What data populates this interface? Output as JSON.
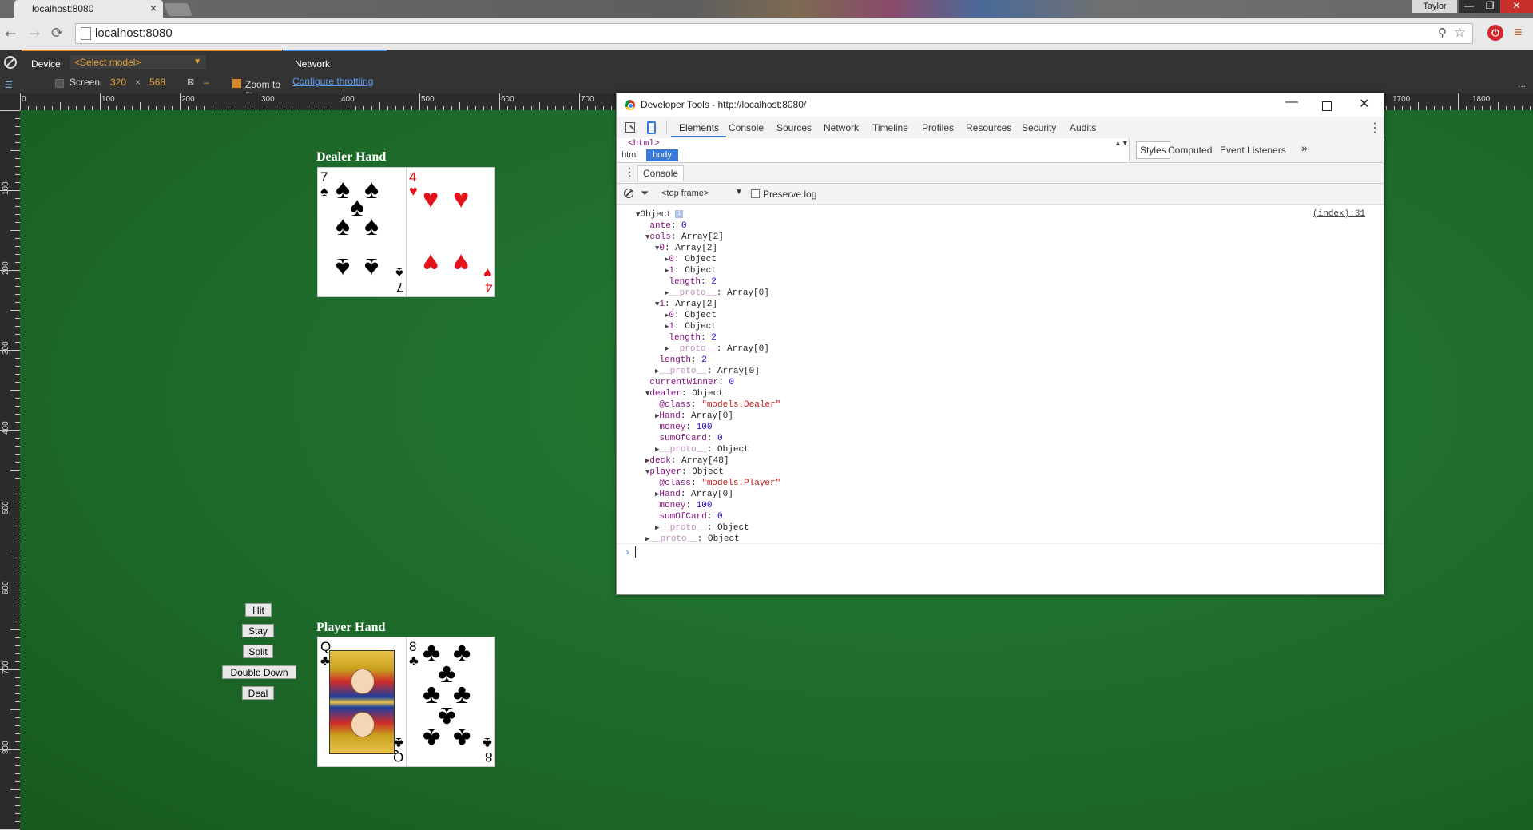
{
  "browser": {
    "tab_title": "localhost:8080",
    "tab_close": "×",
    "url": "localhost:8080",
    "user": "Taylor",
    "win_min": "—",
    "win_max": "❐",
    "win_close": "✕"
  },
  "emulation": {
    "device_label": "Device",
    "model_placeholder": "<Select model>",
    "screen_label": "Screen",
    "screen_width": "320",
    "times": "×",
    "screen_height": "568",
    "dash": "–",
    "zoom_to_fit": "Zoom to fit",
    "network_label": "Network",
    "throttle_link": "Configure throttling",
    "more": "..."
  },
  "ruler": {
    "top": [
      "0",
      "100",
      "200",
      "300",
      "400",
      "500",
      "600",
      "700",
      "1700",
      "1800"
    ],
    "left": [
      "100",
      "200",
      "300",
      "400",
      "500",
      "600",
      "700",
      "800"
    ]
  },
  "game": {
    "dealer_label": "Dealer Hand",
    "player_label": "Player Hand",
    "dealer_cards": [
      {
        "rank": "7",
        "suit": "♠",
        "color": "#000000"
      },
      {
        "rank": "4",
        "suit": "♥",
        "color": "#e3131b"
      }
    ],
    "player_cards": [
      {
        "rank": "Q",
        "suit": "♣",
        "color": "#000000"
      },
      {
        "rank": "8",
        "suit": "♣",
        "color": "#000000"
      }
    ],
    "buttons": {
      "hit": "Hit",
      "stay": "Stay",
      "split": "Split",
      "double_down": "Double Down",
      "deal": "Deal"
    },
    "felt_color": "#1f6b2b"
  },
  "devtools": {
    "title": "Developer Tools - http://localhost:8080/",
    "tabs": [
      "Elements",
      "Console",
      "Sources",
      "Network",
      "Timeline",
      "Profiles",
      "Resources",
      "Security",
      "Audits"
    ],
    "active_tab": "Elements",
    "html_tag": "<html>",
    "breadcrumb_html": "html",
    "breadcrumb_body": "body",
    "style_tabs": [
      "Styles",
      "Computed",
      "Event Listeners"
    ],
    "more_tabs": "»",
    "drawer_tab": "Console",
    "frame": "<top frame>",
    "preserve_log": "Preserve log",
    "source_link": "(index):31",
    "accent": "#3879d9"
  },
  "console_lines": [
    {
      "indent": 0,
      "tri": "▼",
      "key": "Object",
      "val": ""
    },
    {
      "indent": 1,
      "tri": "",
      "key": "ante",
      "val": "0"
    },
    {
      "indent": 1,
      "tri": "▼",
      "key": "cols",
      "val": "Array[2]"
    },
    {
      "indent": 2,
      "tri": "▼",
      "key": "0",
      "val": "Array[2]"
    },
    {
      "indent": 3,
      "tri": "▶",
      "key": "0",
      "val": "Object"
    },
    {
      "indent": 3,
      "tri": "▶",
      "key": "1",
      "val": "Object"
    },
    {
      "indent": 3,
      "tri": "",
      "key": "length",
      "val": "2"
    },
    {
      "indent": 3,
      "tri": "▶",
      "key": "__proto__",
      "val": "Array[0]"
    },
    {
      "indent": 2,
      "tri": "▼",
      "key": "1",
      "val": "Array[2]"
    },
    {
      "indent": 3,
      "tri": "▶",
      "key": "0",
      "val": "Object"
    },
    {
      "indent": 3,
      "tri": "▶",
      "key": "1",
      "val": "Object"
    },
    {
      "indent": 3,
      "tri": "",
      "key": "length",
      "val": "2"
    },
    {
      "indent": 3,
      "tri": "▶",
      "key": "__proto__",
      "val": "Array[0]"
    },
    {
      "indent": 2,
      "tri": "",
      "key": "length",
      "val": "2"
    },
    {
      "indent": 2,
      "tri": "▶",
      "key": "__proto__",
      "val": "Array[0]"
    },
    {
      "indent": 1,
      "tri": "",
      "key": "currentWinner",
      "val": "0"
    },
    {
      "indent": 1,
      "tri": "▼",
      "key": "dealer",
      "val": "Object"
    },
    {
      "indent": 2,
      "tri": "",
      "key": "@class",
      "val": "\"models.Dealer\""
    },
    {
      "indent": 2,
      "tri": "▶",
      "key": "Hand",
      "val": "Array[0]"
    },
    {
      "indent": 2,
      "tri": "",
      "key": "money",
      "val": "100"
    },
    {
      "indent": 2,
      "tri": "",
      "key": "sumOfCard",
      "val": "0"
    },
    {
      "indent": 2,
      "tri": "▶",
      "key": "__proto__",
      "val": "Object"
    },
    {
      "indent": 1,
      "tri": "▶",
      "key": "deck",
      "val": "Array[48]"
    },
    {
      "indent": 1,
      "tri": "▼",
      "key": "player",
      "val": "Object"
    },
    {
      "indent": 2,
      "tri": "",
      "key": "@class",
      "val": "\"models.Player\""
    },
    {
      "indent": 2,
      "tri": "▶",
      "key": "Hand",
      "val": "Array[0]"
    },
    {
      "indent": 2,
      "tri": "",
      "key": "money",
      "val": "100"
    },
    {
      "indent": 2,
      "tri": "",
      "key": "sumOfCard",
      "val": "0"
    },
    {
      "indent": 2,
      "tri": "▶",
      "key": "__proto__",
      "val": "Object"
    },
    {
      "indent": 1,
      "tri": "▶",
      "key": "__proto__",
      "val": "Object"
    }
  ]
}
